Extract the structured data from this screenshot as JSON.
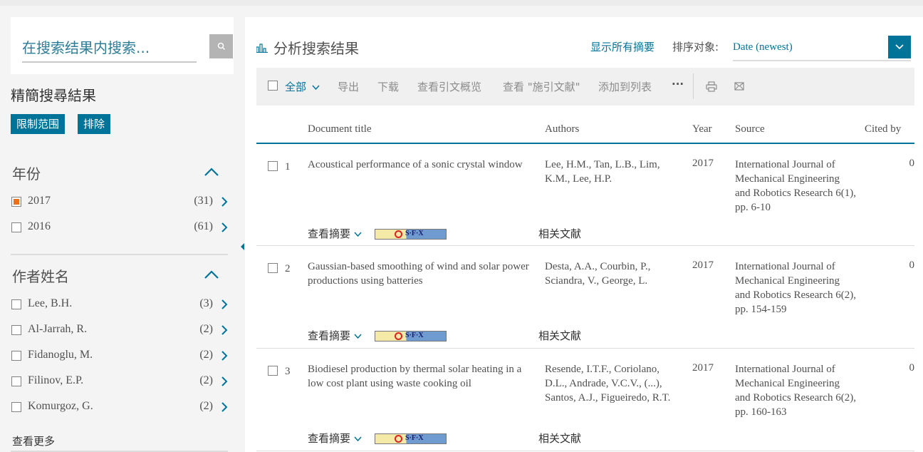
{
  "search": {
    "placeholder": "在搜索结果内搜索..."
  },
  "refine": {
    "title": "精簡搜尋結果",
    "limit_label": "限制范围",
    "exclude_label": "排除"
  },
  "facets": {
    "year": {
      "title": "年份",
      "items": [
        {
          "label": "2017",
          "count": "(31)",
          "checked": true
        },
        {
          "label": "2016",
          "count": "(61)",
          "checked": false
        }
      ]
    },
    "author": {
      "title": "作者姓名",
      "items": [
        {
          "label": "Lee, B.H.",
          "count": "(3)"
        },
        {
          "label": "Al-Jarrah, R.",
          "count": "(2)"
        },
        {
          "label": "Fidanoglu, M.",
          "count": "(2)"
        },
        {
          "label": "Filinov, E.P.",
          "count": "(2)"
        },
        {
          "label": "Komurgoz, G.",
          "count": "(2)"
        }
      ],
      "see_more": "查看更多"
    }
  },
  "header": {
    "analyze_label": "分析搜索结果",
    "show_abstracts": "显示所有摘要",
    "sort_label": "排序对象:",
    "sort_value": "Date (newest)"
  },
  "toolbar": {
    "all_label": "全部",
    "export_label": "导出",
    "download_label": "下载",
    "citation_overview_label": "查看引文概览",
    "cited_by_label": "查看 \"施引文献\"",
    "add_to_list_label": "添加到列表",
    "more_label": "···"
  },
  "table": {
    "columns": [
      "Document title",
      "Authors",
      "Year",
      "Source",
      "Cited by"
    ],
    "rows": [
      {
        "num": "1",
        "title": "Acoustical performance of a sonic crystal window",
        "authors": "Lee, H.M., Tan, L.B., Lim, K.M., Lee, H.P.",
        "year": "2017",
        "source": "International Journal of Mechanical Engineering and Robotics Research 6(1), pp. 6-10",
        "cited": "0",
        "abstract_label": "查看摘要",
        "sfx_label": "S·F·X",
        "related_label": "相关文献"
      },
      {
        "num": "2",
        "title": "Gaussian-based smoothing of wind and solar power productions using batteries",
        "authors": "Desta, A.A., Courbin, P., Sciandra, V., George, L.",
        "year": "2017",
        "source": "International Journal of Mechanical Engineering and Robotics Research 6(2), pp. 154-159",
        "cited": "0",
        "abstract_label": "查看摘要",
        "sfx_label": "S·F·X",
        "related_label": "相关文献"
      },
      {
        "num": "3",
        "title": "Biodiesel production by thermal solar heating in a low cost plant using waste cooking oil",
        "authors": "Resende, I.T.F., Coriolano, D.L., Andrade, V.C.V., (...), Santos, A.J., Figueiredo, R.T.",
        "year": "2017",
        "source": "International Journal of Mechanical Engineering and Robotics Research 6(2), pp. 160-163",
        "cited": "0",
        "abstract_label": "查看摘要",
        "sfx_label": "S·F·X",
        "related_label": "相关文献"
      }
    ]
  },
  "colors": {
    "accent": "#007398",
    "checked": "#e9711c"
  }
}
